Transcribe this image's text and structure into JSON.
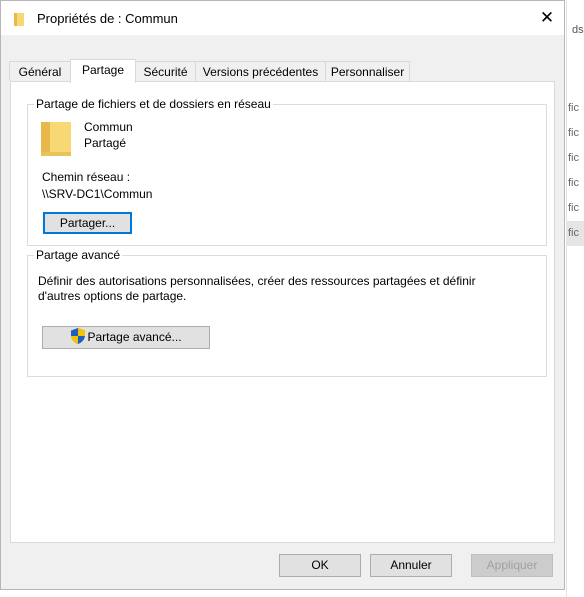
{
  "background": {
    "top_text": "ds",
    "list_items": [
      "fic",
      "fic",
      "fic",
      "fic",
      "fic",
      "fic"
    ]
  },
  "window": {
    "title": "Propriétés de : Commun",
    "close_glyph": "✕"
  },
  "tabs": [
    {
      "label": "Général"
    },
    {
      "label": "Partage"
    },
    {
      "label": "Sécurité"
    },
    {
      "label": "Versions précédentes"
    },
    {
      "label": "Personnaliser"
    }
  ],
  "network_sharing": {
    "group_title": "Partage de fichiers et de dossiers en réseau",
    "folder_name": "Commun",
    "status": "Partagé",
    "path_label": "Chemin réseau :",
    "path_value": "\\\\SRV-DC1\\Commun",
    "share_button": "Partager..."
  },
  "advanced_sharing": {
    "group_title": "Partage avancé",
    "description_line1": "Définir des autorisations personnalisées, créer des ressources partagées et définir",
    "description_line2": "d'autres options de partage.",
    "button_label": "Partage avancé..."
  },
  "footer": {
    "ok": "OK",
    "cancel": "Annuler",
    "apply": "Appliquer"
  },
  "colors": {
    "folder": "#f8d775",
    "accent": "#0078d7",
    "shield_blue": "#1f5fbf",
    "shield_yellow": "#f5c400"
  },
  "icons": {
    "title": "folder-icon",
    "big_folder": "folder-icon",
    "uac": "uac-shield-icon",
    "close": "close-icon"
  }
}
